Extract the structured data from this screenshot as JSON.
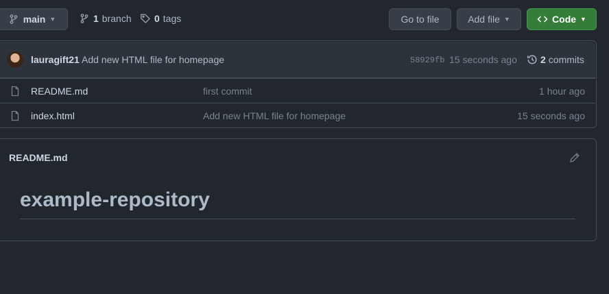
{
  "toolbar": {
    "branch_selector": "main",
    "branch_count": "1",
    "branch_word": "branch",
    "tag_count": "0",
    "tag_word": "tags",
    "go_to_file": "Go to file",
    "add_file": "Add file",
    "code": "Code"
  },
  "latest_commit": {
    "author": "lauragift21",
    "message": "Add new HTML file for homepage",
    "sha": "58929fb",
    "time": "15 seconds ago",
    "commit_count": "2",
    "commit_word": "commits"
  },
  "files": [
    {
      "name": "README.md",
      "commit_message": "first commit",
      "time": "1 hour ago",
      "icon": "file-icon"
    },
    {
      "name": "index.html",
      "commit_message": "Add new HTML file for homepage",
      "time": "15 seconds ago",
      "icon": "file-icon"
    }
  ],
  "readme": {
    "filename": "README.md",
    "heading": "example-repository"
  },
  "colors": {
    "background": "#22272e",
    "code_button": "#347d39",
    "border": "#444c56"
  }
}
